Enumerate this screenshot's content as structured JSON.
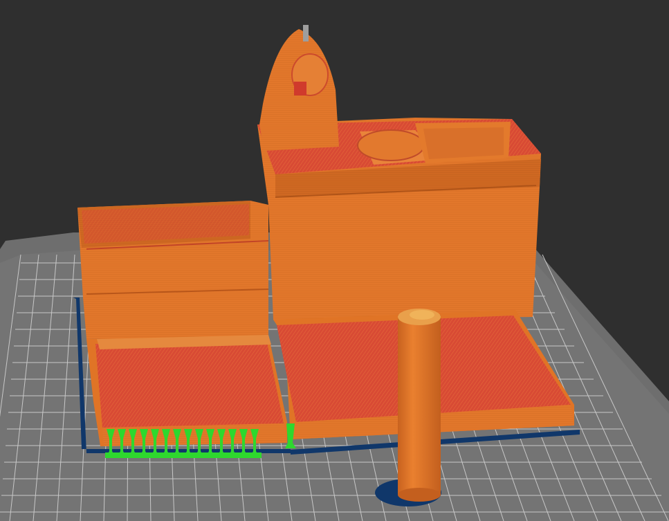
{
  "app": {
    "view": "3d-print-preview"
  },
  "colors": {
    "background": "#2f2f2f",
    "build_plate": "#6e6e6e",
    "grid_line": "#c8c8c8",
    "wall": "#e0762a",
    "infill": "#d94a34",
    "support": "#2ed82e",
    "skirt": "#10376a"
  },
  "scene": {
    "objects": [
      {
        "name": "model-body",
        "type": "print-model"
      },
      {
        "name": "support-structures",
        "type": "support"
      },
      {
        "name": "skirt-brim",
        "type": "skirt"
      }
    ]
  }
}
